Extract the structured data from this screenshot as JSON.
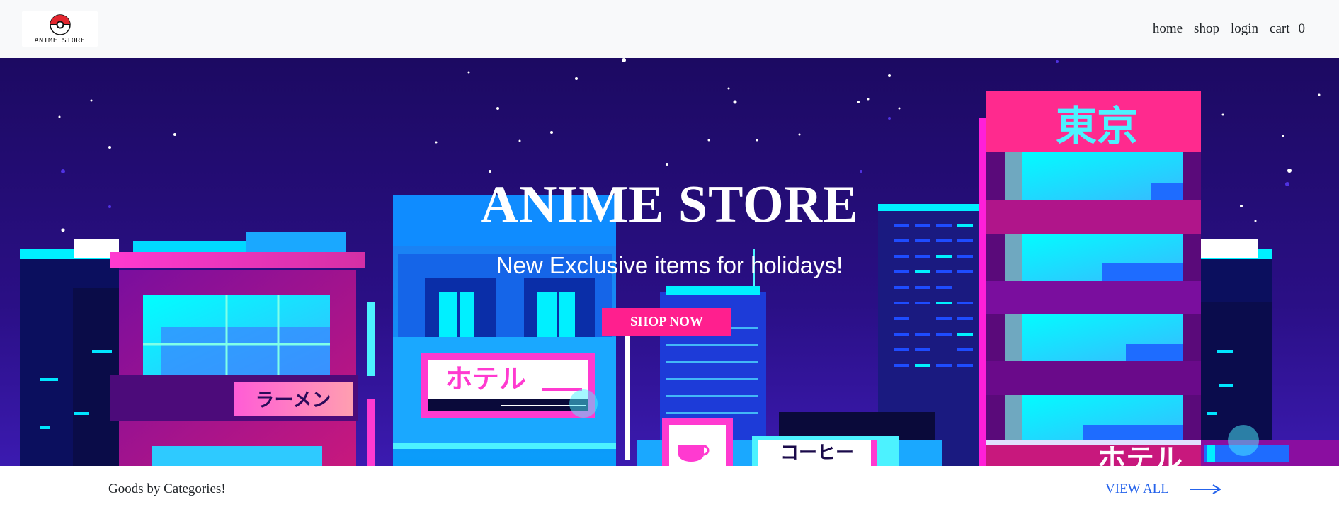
{
  "nav": {
    "logo_text": "ANIME STORE",
    "links": [
      {
        "label": "home"
      },
      {
        "label": "shop"
      },
      {
        "label": "login"
      },
      {
        "label": "cart"
      }
    ],
    "cart_count": "0"
  },
  "hero": {
    "title": "ANIME STORE",
    "subtitle": "New Exclusive items for holidays!",
    "cta_label": "SHOP NOW",
    "signs": {
      "tokyo": "東京",
      "hotel": "ホテル",
      "ramen": "ラーメン",
      "coffee": "コーヒー",
      "hotel_bottom": "ホテル"
    }
  },
  "categories": {
    "title": "Goods by Categories!",
    "view_all_label": "VIEW ALL"
  },
  "colors": {
    "accent_pink": "#ff1f8e",
    "link_blue": "#2563eb",
    "sky": "#1f0a6b",
    "neon_cyan": "#00f5ff"
  }
}
